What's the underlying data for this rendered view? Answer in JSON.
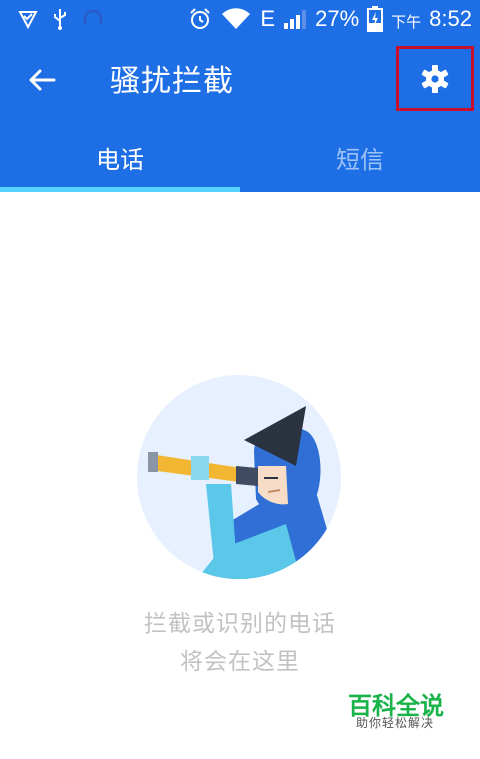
{
  "status_bar": {
    "network_type": "E",
    "battery": "27%",
    "ampm": "下午",
    "time": "8:52"
  },
  "app_bar": {
    "title": "骚扰拦截"
  },
  "tabs": [
    {
      "label": "电话",
      "selected": true
    },
    {
      "label": "短信",
      "selected": false
    }
  ],
  "empty_state": {
    "line1": "拦截或识别的电话",
    "line2": "将会在这里"
  },
  "watermark": {
    "title": "百科全说",
    "subtitle": "助你轻松解决"
  },
  "icons": {
    "back": "arrow-left-icon",
    "settings": "gear-icon"
  },
  "colors": {
    "primary": "#1e6fe6",
    "tab_indicator": "#56d3ff",
    "highlight_box": "#c8102e",
    "empty_text": "#c2c2c2",
    "watermark": "#19b34a"
  }
}
